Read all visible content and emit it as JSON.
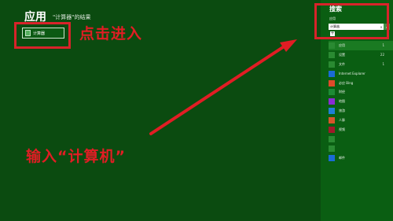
{
  "main": {
    "title": "应用",
    "result_text": "\"计算器\"的结果",
    "result_tile_label": "计算器"
  },
  "annotations": {
    "click_enter": "点击进入",
    "type_calc": "输入“计算机”",
    "color": "#e11d24"
  },
  "search_panel": {
    "title": "搜索",
    "scope": "应用",
    "query": "计算器",
    "clear_icon": "×",
    "go_icon": "⌕",
    "plus_icon": "+",
    "categories": [
      {
        "label": "应用",
        "count": "1",
        "icon": "apps-icon"
      },
      {
        "label": "设置",
        "count": "22",
        "icon": "settings-icon"
      },
      {
        "label": "文件",
        "count": "1",
        "icon": "files-icon"
      }
    ],
    "apps": [
      {
        "label": "Internet Explorer",
        "icon": "ie-icon"
      },
      {
        "label": "必应 Bing",
        "icon": "bing-icon"
      },
      {
        "label": "财经",
        "icon": "finance-icon"
      },
      {
        "label": "地图",
        "icon": "maps-icon"
      },
      {
        "label": "旅游",
        "icon": "travel-icon"
      },
      {
        "label": "人脉",
        "icon": "people-icon"
      },
      {
        "label": "视频",
        "icon": "video-icon"
      },
      {
        "label": "",
        "icon": "store-icon"
      },
      {
        "label": "",
        "icon": "music-icon"
      },
      {
        "label": "邮件",
        "icon": "mail-icon"
      }
    ]
  }
}
